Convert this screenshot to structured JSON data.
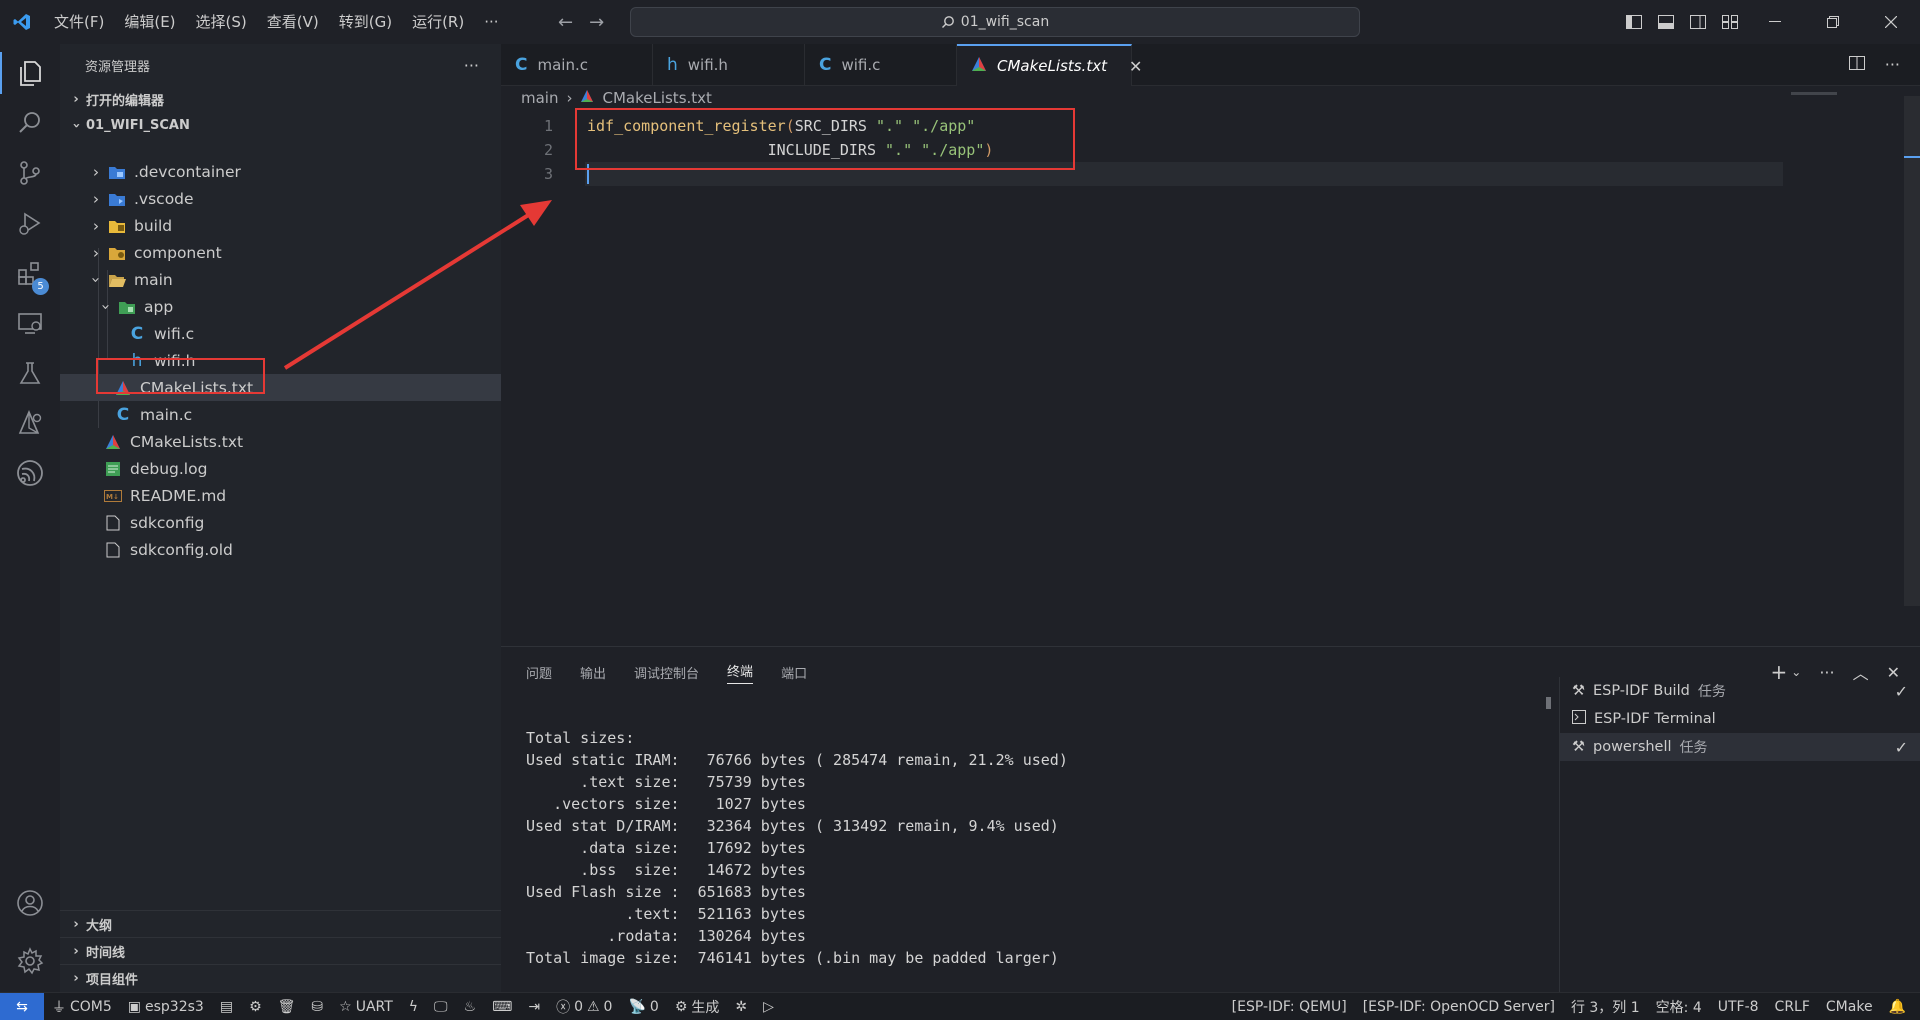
{
  "menu": [
    "文件(F)",
    "编辑(E)",
    "选择(S)",
    "查看(V)",
    "转到(G)",
    "运行(R)",
    "···"
  ],
  "search": {
    "text": "01_wifi_scan"
  },
  "sidebar": {
    "title": "资源管理器",
    "open_editors": "打开的编辑器",
    "workspace": "01_WIFI_SCAN",
    "tree": [
      {
        "label": ".devcontainer",
        "icon": "devcontainer-folder-icon"
      },
      {
        "label": ".vscode",
        "icon": "vscode-folder-icon"
      },
      {
        "label": "build",
        "icon": "build-folder-icon"
      },
      {
        "label": "component",
        "icon": "component-folder-icon"
      },
      {
        "label": "main",
        "icon": "open-folder-icon"
      },
      {
        "label": "app",
        "icon": "app-folder-icon"
      },
      {
        "label": "wifi.c",
        "icon": "c-file-icon"
      },
      {
        "label": "wifi.h",
        "icon": "h-file-icon"
      },
      {
        "label": "CMakeLists.txt",
        "icon": "cmake-icon"
      },
      {
        "label": "main.c",
        "icon": "c-file-icon"
      },
      {
        "label": "CMakeLists.txt",
        "icon": "cmake-icon"
      },
      {
        "label": "debug.log",
        "icon": "log-file-icon"
      },
      {
        "label": "README.md",
        "icon": "markdown-icon"
      },
      {
        "label": "sdkconfig",
        "icon": "file-icon"
      },
      {
        "label": "sdkconfig.old",
        "icon": "file-icon"
      }
    ],
    "bottom": [
      "大纲",
      "时间线",
      "项目组件"
    ]
  },
  "tabs": [
    {
      "label": "main.c",
      "icon": "C"
    },
    {
      "label": "wifi.h",
      "icon": "h"
    },
    {
      "label": "wifi.c",
      "icon": "C"
    },
    {
      "label": "CMakeLists.txt",
      "icon": "cmake",
      "close": "✕"
    }
  ],
  "breadcrumb": {
    "folder": "main",
    "file": "CMakeLists.txt"
  },
  "code": {
    "line_numbers": [
      "1",
      "2",
      "3"
    ],
    "fn": "idf_component_register",
    "open_paren": "(",
    "kw1": "SRC_DIRS ",
    "s1": "\".\"",
    "sp1": " ",
    "s2": "\"./app\"",
    "indent2": "                    ",
    "kw2": "INCLUDE_DIRS ",
    "s3": "\".\"",
    "sp2": " ",
    "s4": "\"./app\"",
    "close_paren": ")"
  },
  "panel": {
    "tabs": [
      "问题",
      "输出",
      "调试控制台",
      "终端",
      "端口"
    ],
    "terminal_lines": [
      "Total sizes:",
      "Used static IRAM:   76766 bytes ( 285474 remain, 21.2% used)",
      "      .text size:   75739 bytes",
      "   .vectors size:    1027 bytes",
      "Used stat D/IRAM:   32364 bytes ( 313492 remain, 9.4% used)",
      "      .data size:   17692 bytes",
      "      .bss  size:   14672 bytes",
      "Used Flash size :  651683 bytes",
      "           .text:  521163 bytes",
      "         .rodata:  130264 bytes",
      "Total image size:  746141 bytes (.bin may be padded larger)"
    ],
    "terminals": [
      {
        "name": "ESP-IDF Build",
        "tag": "任务",
        "check": "✓"
      },
      {
        "name": "ESP-IDF Terminal",
        "tag": "",
        "check": ""
      },
      {
        "name": "powershell",
        "tag": "任务",
        "check": "✓"
      }
    ]
  },
  "statusbar": {
    "port": "COM5",
    "target": "esp32s3",
    "uart": "UART",
    "errors": "0",
    "warnings": "0",
    "ports": "0",
    "build": "生成",
    "qemu": "[ESP-IDF: QEMU]",
    "openocd": "[ESP-IDF: OpenOCD Server]",
    "position": "行 3，列 1",
    "spaces": "空格: 4",
    "encoding": "UTF-8",
    "eol": "CRLF",
    "language": "CMake"
  },
  "activity_badge": "5",
  "colors": {
    "accent": "#5aa0f0",
    "annotation": "#e53935",
    "string": "#98c379",
    "function": "#e5c07b"
  }
}
